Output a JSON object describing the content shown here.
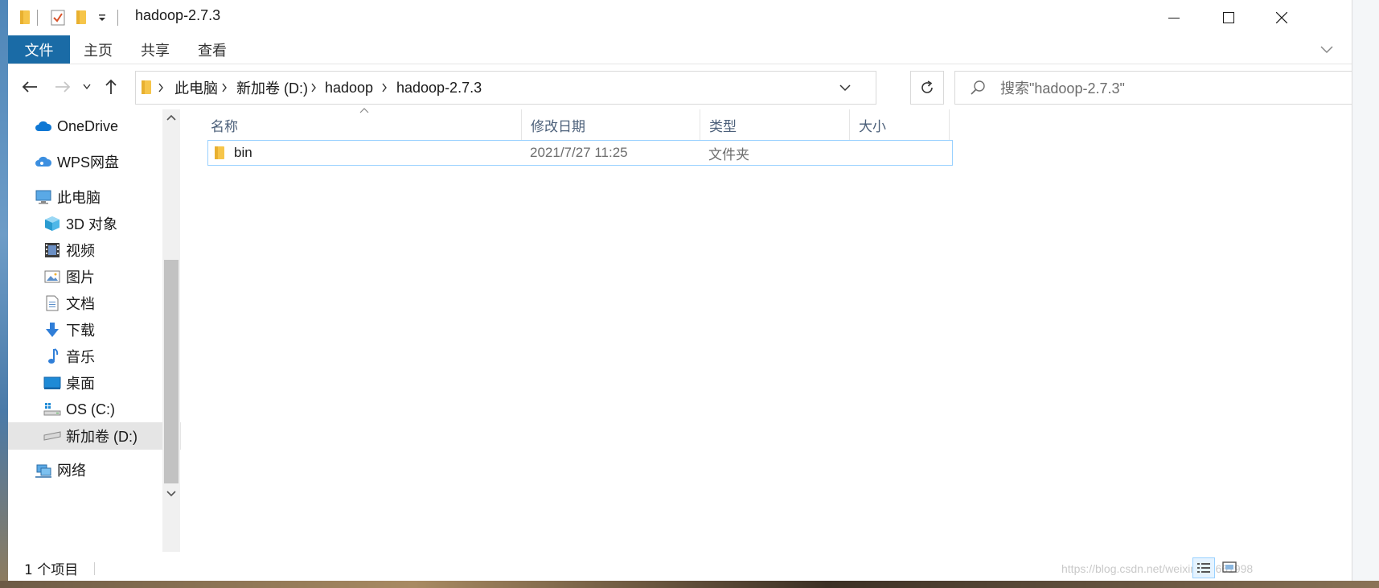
{
  "window": {
    "title": "hadoop-2.7.3",
    "controls": {
      "minimize": "minimize",
      "maximize": "maximize",
      "close": "close"
    }
  },
  "ribbon": {
    "tabs": [
      {
        "label": "文件",
        "active": true
      },
      {
        "label": "主页",
        "active": false
      },
      {
        "label": "共享",
        "active": false
      },
      {
        "label": "查看",
        "active": false
      }
    ]
  },
  "address": {
    "crumbs": [
      "此电脑",
      "新加卷 (D:)",
      "hadoop",
      "hadoop-2.7.3"
    ]
  },
  "search": {
    "placeholder": "搜索\"hadoop-2.7.3\""
  },
  "nav_pane": {
    "items": [
      {
        "label": "OneDrive",
        "icon": "cloud-icon"
      },
      {
        "label": "WPS网盘",
        "icon": "wps-cloud-icon"
      },
      {
        "label": "此电脑",
        "icon": "computer-icon"
      },
      {
        "label": "3D 对象",
        "icon": "cube-icon"
      },
      {
        "label": "视频",
        "icon": "video-icon"
      },
      {
        "label": "图片",
        "icon": "picture-icon"
      },
      {
        "label": "文档",
        "icon": "document-icon"
      },
      {
        "label": "下载",
        "icon": "download-icon"
      },
      {
        "label": "音乐",
        "icon": "music-icon"
      },
      {
        "label": "桌面",
        "icon": "desktop-icon"
      },
      {
        "label": "OS (C:)",
        "icon": "drive-c-icon"
      },
      {
        "label": "新加卷 (D:)",
        "icon": "drive-d-icon",
        "selected": true
      },
      {
        "label": "网络",
        "icon": "network-icon"
      }
    ]
  },
  "columns": {
    "name": "名称",
    "modified": "修改日期",
    "type": "类型",
    "size": "大小"
  },
  "files": [
    {
      "name": "bin",
      "modified": "2021/7/27 11:25",
      "type": "文件夹",
      "size": ""
    }
  ],
  "status": {
    "item_count": "1 个项目"
  },
  "watermark": "https://blog.csdn.net/weixin_45661998",
  "colors": {
    "accent": "#1a6ba6",
    "selection_border": "#99d1ff",
    "nav_selected": "#cce4f7",
    "folder": "#f6c54a"
  }
}
